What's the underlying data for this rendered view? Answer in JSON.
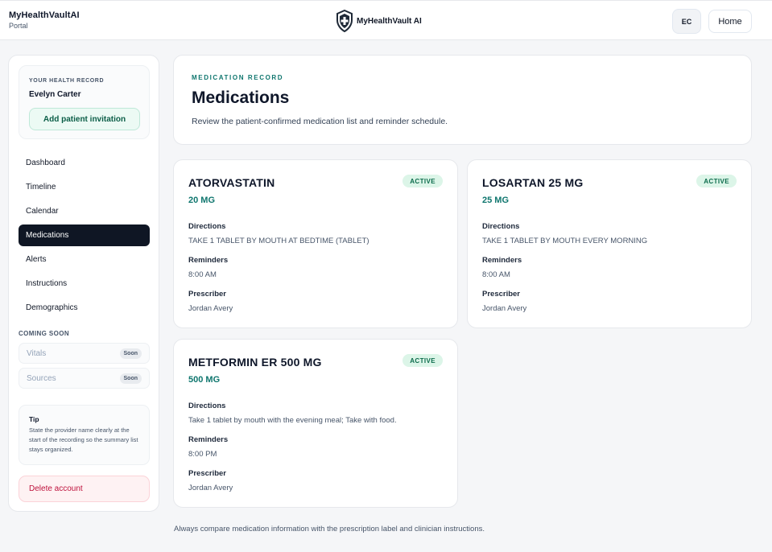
{
  "header": {
    "brand_name": "MyHealthVaultAI",
    "brand_sub": "Portal",
    "logo_text": "MyHealthVault AI",
    "avatar_initials": "EC",
    "home_label": "Home"
  },
  "sidebar": {
    "record_eyebrow": "YOUR HEALTH RECORD",
    "patient_name": "Evelyn Carter",
    "invite_label": "Add patient invitation",
    "nav": [
      {
        "label": "Dashboard",
        "active": false
      },
      {
        "label": "Timeline",
        "active": false
      },
      {
        "label": "Calendar",
        "active": false
      },
      {
        "label": "Medications",
        "active": true
      },
      {
        "label": "Alerts",
        "active": false
      },
      {
        "label": "Instructions",
        "active": false
      },
      {
        "label": "Demographics",
        "active": false
      }
    ],
    "coming_soon_heading": "COMING SOON",
    "coming_soon": [
      {
        "label": "Vitals",
        "badge": "Soon"
      },
      {
        "label": "Sources",
        "badge": "Soon"
      }
    ],
    "tip_title": "Tip",
    "tip_text": "State the provider name clearly at the start of the recording so the summary list stays organized.",
    "delete_label": "Delete account"
  },
  "main": {
    "eyebrow": "MEDICATION RECORD",
    "title": "Medications",
    "subtitle": "Review the patient-confirmed medication list and reminder schedule.",
    "field_labels": {
      "directions": "Directions",
      "reminders": "Reminders",
      "prescriber": "Prescriber"
    },
    "medications": [
      {
        "name": "ATORVASTATIN",
        "dose": "20 MG",
        "status": "ACTIVE",
        "directions": "TAKE 1 TABLET BY MOUTH AT BEDTIME (TABLET)",
        "reminders": "8:00 AM",
        "prescriber": "Jordan Avery"
      },
      {
        "name": "LOSARTAN 25 MG",
        "dose": "25 MG",
        "status": "ACTIVE",
        "directions": "TAKE 1 TABLET BY MOUTH EVERY MORNING",
        "reminders": "8:00 AM",
        "prescriber": "Jordan Avery"
      },
      {
        "name": "METFORMIN ER 500 MG",
        "dose": "500 MG",
        "status": "ACTIVE",
        "directions": "Take 1 tablet by mouth with the evening meal; Take with food.",
        "reminders": "8:00 PM",
        "prescriber": "Jordan Avery"
      }
    ],
    "footer_note": "Always compare medication information with the prescription label and clinician instructions."
  },
  "colors": {
    "accent_teal": "#0f766e",
    "active_nav_bg": "#0f1624",
    "status_badge_bg": "#dcf5e8",
    "danger": "#be123c"
  }
}
